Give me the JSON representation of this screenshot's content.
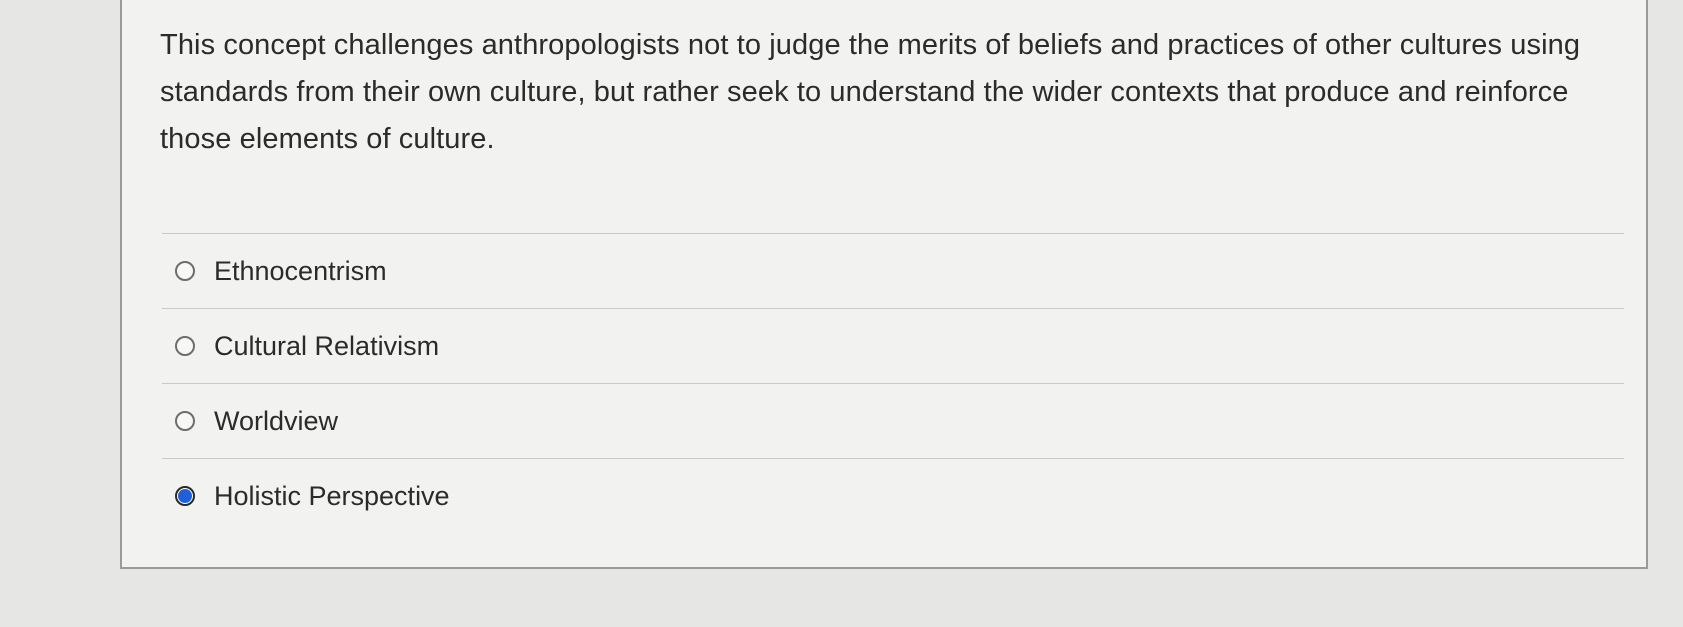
{
  "question": {
    "text": "This concept challenges anthropologists not to judge the merits of beliefs and practices of other cultures using standards from their own culture, but rather seek to understand the wider contexts that produce and reinforce those elements of culture."
  },
  "answers": [
    {
      "label": "Ethnocentrism",
      "selected": false
    },
    {
      "label": "Cultural Relativism",
      "selected": false
    },
    {
      "label": "Worldview",
      "selected": false
    },
    {
      "label": "Holistic Perspective",
      "selected": true
    }
  ],
  "colors": {
    "page_background": "#e6e6e4",
    "card_background": "#f2f2f0",
    "text": "#2b2b2b",
    "radio_selected": "#1f5fd8"
  }
}
